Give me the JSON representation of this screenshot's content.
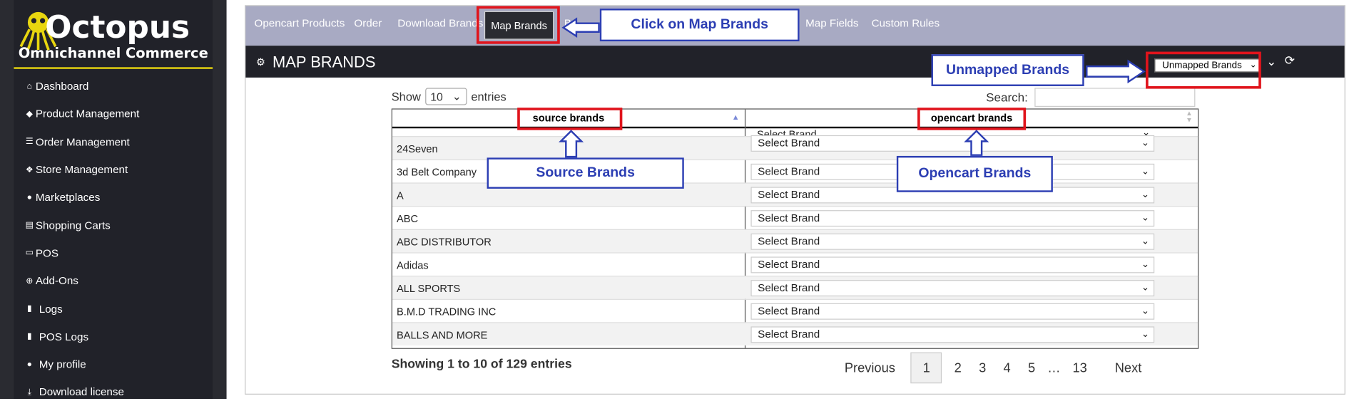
{
  "brand": {
    "name": "Octopus",
    "tagline": "Omnichannel Commerce"
  },
  "sidebar": {
    "items": [
      {
        "label": "Dashboard",
        "icon": "home-icon"
      },
      {
        "label": "Product Management",
        "icon": "tag-icon"
      },
      {
        "label": "Order Management",
        "icon": "list-icon"
      },
      {
        "label": "Store Management",
        "icon": "cubes-icon"
      },
      {
        "label": "Marketplaces",
        "icon": "globe-icon"
      },
      {
        "label": "Shopping Carts",
        "icon": "cart-icon"
      },
      {
        "label": "POS",
        "icon": "laptop-icon"
      },
      {
        "label": "Add-Ons",
        "icon": "plus-circle-icon"
      },
      {
        "label": "Logs",
        "icon": "file-icon"
      },
      {
        "label": "POS Logs",
        "icon": "file-icon"
      },
      {
        "label": "My profile",
        "icon": "user-icon"
      },
      {
        "label": "Download license",
        "icon": "download-icon"
      }
    ]
  },
  "topnav": {
    "tabs": [
      "Opencart Products",
      "Order",
      "Download Brands",
      "Map Brands",
      "B",
      "Map Fields",
      "Custom Rules"
    ],
    "active": "Map Brands"
  },
  "page": {
    "title": "MAP BRANDS",
    "filter_value": "Unmapped Brands"
  },
  "table_controls": {
    "show_label": "Show",
    "length_value": "10",
    "entries_label": "entries",
    "search_label": "Search:"
  },
  "table": {
    "headers": [
      "source brands",
      "opencart brands"
    ],
    "select_placeholder": "Select Brand",
    "rows": [
      "24Seven",
      "3d Belt Company",
      "A",
      "ABC",
      "ABC DISTRIBUTOR",
      "Adidas",
      "ALL SPORTS",
      "B.M.D TRADING INC",
      "BALLS AND MORE"
    ]
  },
  "footer": {
    "info": "Showing 1 to 10 of 129 entries",
    "previous": "Previous",
    "pages": [
      "1",
      "2",
      "3",
      "4",
      "5"
    ],
    "ellipsis": "…",
    "last_page": "13",
    "next": "Next"
  },
  "annotations": {
    "click_map_brands": "Click on Map Brands",
    "unmapped_brands": "Unmapped Brands",
    "source_brands": "Source Brands",
    "opencart_brands": "Opencart Brands"
  },
  "colors": {
    "annotation_red": "#e0141c",
    "annotation_blue": "#2c3eb3",
    "nav_bg": "#a8aac3",
    "sidebar_bg": "#212229",
    "logo_underline": "#e8d60f"
  }
}
